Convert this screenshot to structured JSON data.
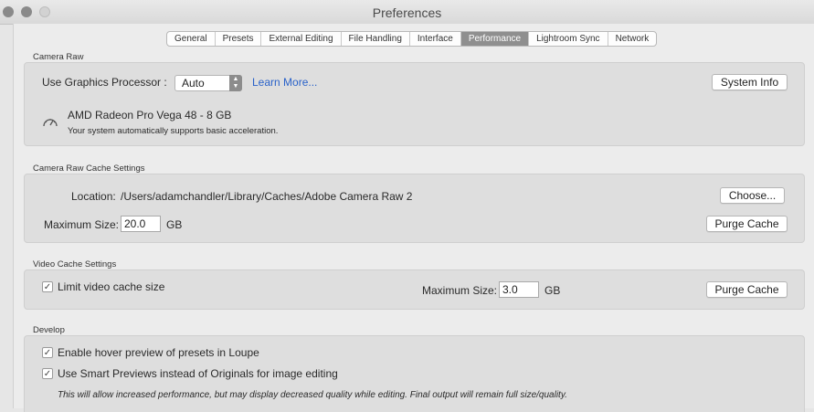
{
  "window": {
    "title": "Preferences"
  },
  "tabs": [
    {
      "label": "General"
    },
    {
      "label": "Presets"
    },
    {
      "label": "External Editing"
    },
    {
      "label": "File Handling"
    },
    {
      "label": "Interface"
    },
    {
      "label": "Performance",
      "active": true
    },
    {
      "label": "Lightroom Sync"
    },
    {
      "label": "Network"
    }
  ],
  "camera_raw": {
    "section_title": "Camera Raw",
    "gpu_label": "Use Graphics Processor :",
    "gpu_value": "Auto",
    "learn_more": "Learn More...",
    "system_info": "System Info",
    "gpu_name": "AMD Radeon Pro Vega 48 - 8 GB",
    "gpu_status": "Your system automatically supports basic acceleration.",
    "icon": "speedometer-icon"
  },
  "cache": {
    "section_title": "Camera Raw Cache Settings",
    "location_label": "Location:",
    "location_value": "/Users/adamchandler/Library/Caches/Adobe Camera Raw 2",
    "choose": "Choose...",
    "max_size_label": "Maximum Size:",
    "max_size_value": "20.0",
    "unit": "GB",
    "purge": "Purge Cache"
  },
  "video": {
    "section_title": "Video Cache Settings",
    "limit_label": "Limit video cache size",
    "limit_checked": true,
    "max_size_label": "Maximum Size:",
    "max_size_value": "3.0",
    "unit": "GB",
    "purge": "Purge Cache"
  },
  "develop": {
    "section_title": "Develop",
    "hover_label": "Enable hover preview of presets in Loupe",
    "hover_checked": true,
    "smart_label": "Use Smart Previews instead of Originals for image editing",
    "smart_checked": true,
    "smart_note": "This will allow increased performance, but may display decreased quality while editing. Final output will remain full size/quality."
  },
  "glyphs": {
    "check": "✓",
    "up": "▲",
    "down": "▼"
  }
}
